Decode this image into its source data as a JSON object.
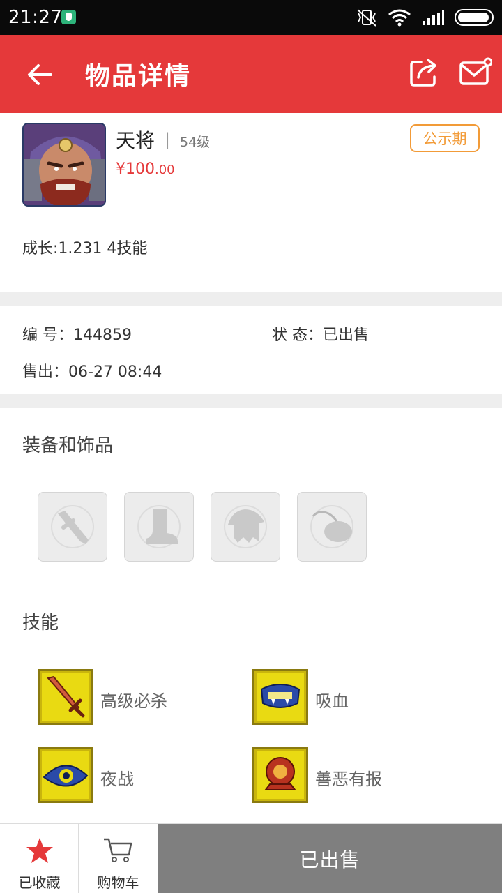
{
  "status_bar": {
    "time": "21:27",
    "icons": [
      "shield-icon",
      "vibrate-off-icon",
      "wifi-icon",
      "signal-icon",
      "battery-icon"
    ]
  },
  "header": {
    "title": "物品详情",
    "icons": [
      "back-arrow-icon",
      "share-icon",
      "mail-icon"
    ]
  },
  "item": {
    "name": "天将",
    "separator": "|",
    "level": "54级",
    "price_main": "¥100",
    "price_decimal": ".00",
    "badge": "公示期",
    "growth_text": "成长:1.231 4技能"
  },
  "info": {
    "id_label": "编 号：",
    "id_value": "144859",
    "status_label": "状 态：",
    "status_value": "已出售",
    "sold_label": "售出：",
    "sold_value": "06-27 08:44"
  },
  "equipment": {
    "title": "装备和饰品",
    "slots": [
      "weapon-slot-icon",
      "boots-slot-icon",
      "armor-slot-icon",
      "accessory-slot-icon"
    ]
  },
  "skills": {
    "title": "技能",
    "items": [
      {
        "name": "高级必杀",
        "icon": "sword-skill-icon"
      },
      {
        "name": "吸血",
        "icon": "vampire-skill-icon"
      },
      {
        "name": "夜战",
        "icon": "eye-skill-icon"
      },
      {
        "name": "善恶有报",
        "icon": "karma-skill-icon"
      }
    ]
  },
  "colors": {
    "primary": "#e5393a",
    "badge": "#f29b38",
    "sold_button": "#7f7f7f",
    "skill_bg": "#e9da12"
  },
  "bottom_bar": {
    "favorite_label": "已收藏",
    "cart_label": "购物车",
    "sold_label": "已出售"
  }
}
